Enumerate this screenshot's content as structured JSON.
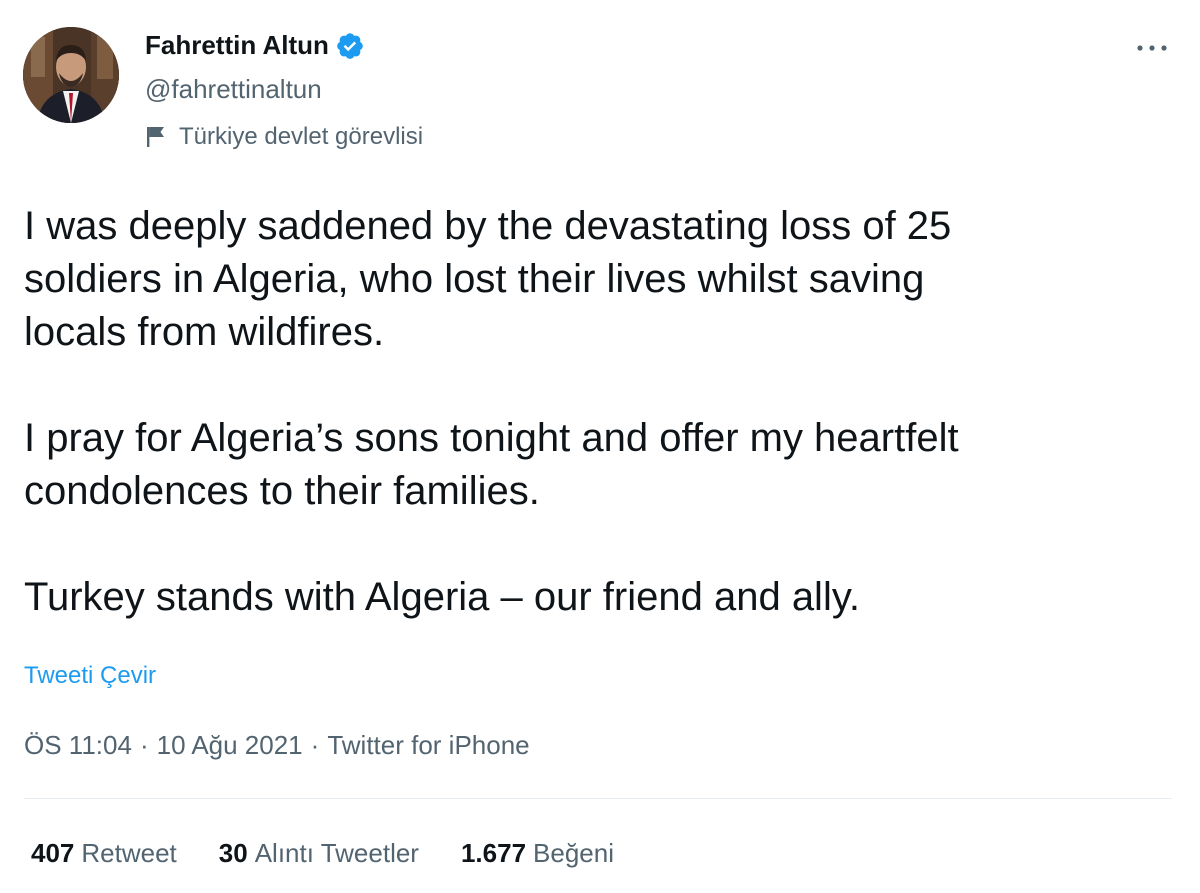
{
  "author": {
    "name": "Fahrettin Altun",
    "handle": "@fahrettinaltun",
    "affiliation": "Türkiye devlet görevlisi"
  },
  "tweet": {
    "paragraphs": [
      "I was deeply saddened by the devastating loss of 25\nsoldiers in Algeria, who lost their lives whilst saving\nlocals from wildfires.",
      "I pray for Algeria’s sons tonight and offer my heartfelt\ncondolences to their families.",
      "Turkey stands with Algeria – our friend and ally."
    ],
    "translate_label": "Tweeti Çevir",
    "time": "ÖS 11:04",
    "separator": "·",
    "date": "10 Ağu 2021",
    "source": "Twitter for iPhone"
  },
  "stats": {
    "retweets": {
      "count": "407",
      "label": "Retweet"
    },
    "quotes": {
      "count": "30",
      "label": "Alıntı Tweetler"
    },
    "likes": {
      "count": "1.677",
      "label": "Beğeni"
    }
  },
  "colors": {
    "accent": "#1d9bf0",
    "text_primary": "#0f1419",
    "text_secondary": "#536471"
  },
  "icons": {
    "verified": "verified-badge-icon",
    "affiliation": "flag-icon",
    "more": "more-horizontal-icon"
  }
}
